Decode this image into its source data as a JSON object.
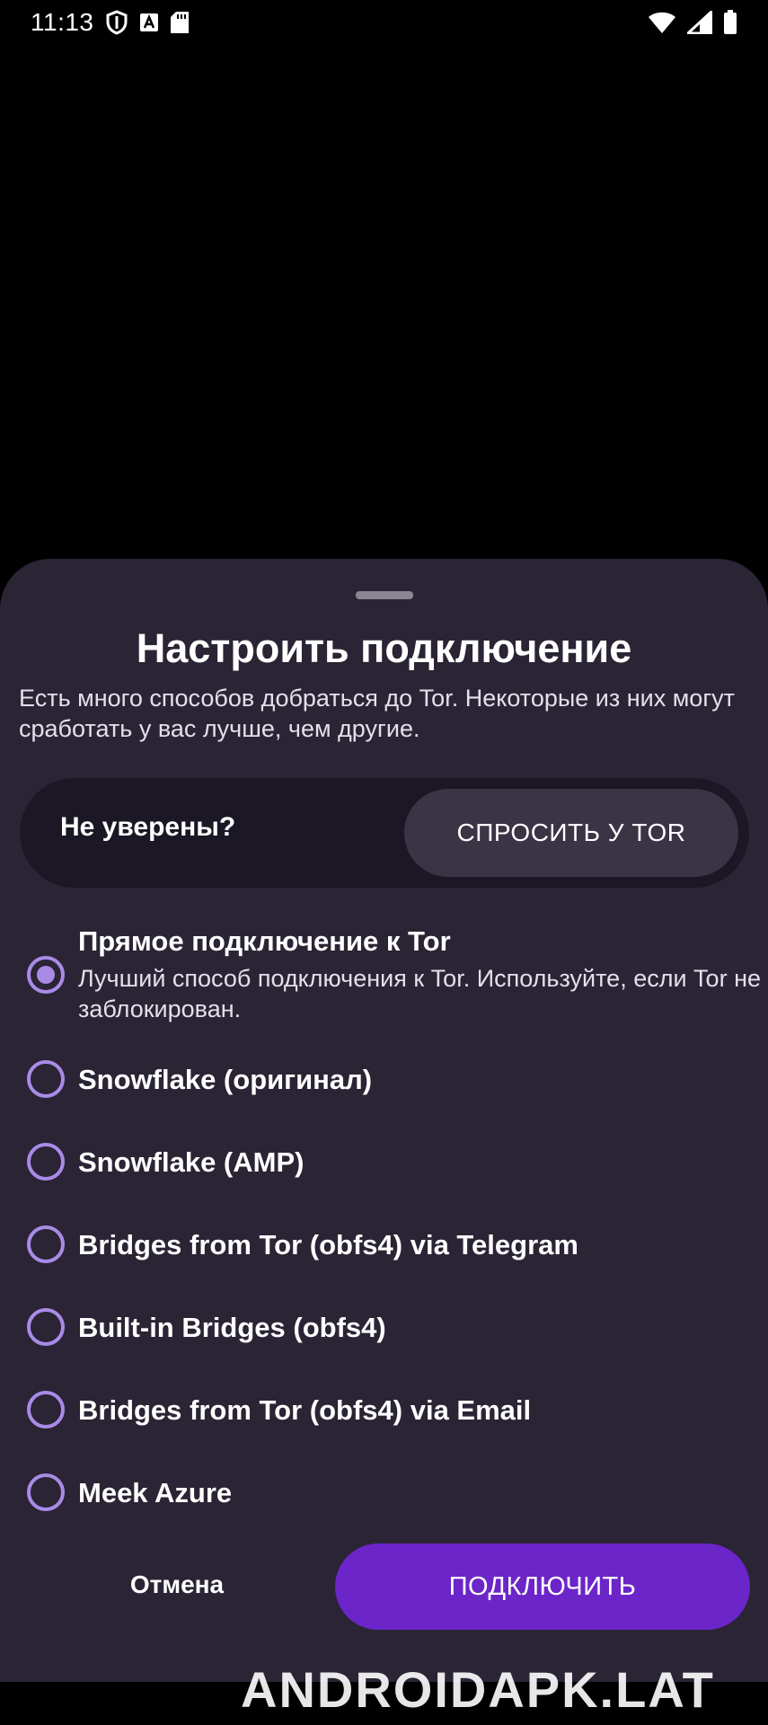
{
  "status_bar": {
    "time": "11:13",
    "left_icons": [
      "shield-icon",
      "font-a-icon",
      "sd-card-icon"
    ],
    "right_icons": [
      "wifi-icon",
      "signal-icon",
      "battery-icon"
    ]
  },
  "sheet": {
    "title": "Настроить подключение",
    "description": "Есть много способов добраться до Tor. Некоторые из них могут сработать у вас лучше, чем другие.",
    "unsure_label": "Не уверены?",
    "ask_tor_label": "СПРОСИТЬ У TOR",
    "options": [
      {
        "title": "Прямое подключение к Tor",
        "description": "Лучший способ подключения к Tor. Используйте, если Tor не заблокирован.",
        "selected": true
      },
      {
        "title": "Snowflake (оригинал)",
        "selected": false
      },
      {
        "title": "Snowflake (AMP)",
        "selected": false
      },
      {
        "title": "Bridges from Tor (obfs4) via Telegram",
        "selected": false
      },
      {
        "title": "Built-in Bridges (obfs4)",
        "selected": false
      },
      {
        "title": "Bridges from Tor (obfs4) via Email",
        "selected": false
      },
      {
        "title": "Meek Azure",
        "selected": false
      }
    ],
    "cancel_label": "Отмена",
    "connect_label": "ПОДКЛЮЧИТЬ"
  },
  "watermark": "ANDROIDAPK.LAT",
  "colors": {
    "sheet_bg": "#2a2435",
    "accent": "#a98be6",
    "connect_button": "#6c25c9"
  }
}
